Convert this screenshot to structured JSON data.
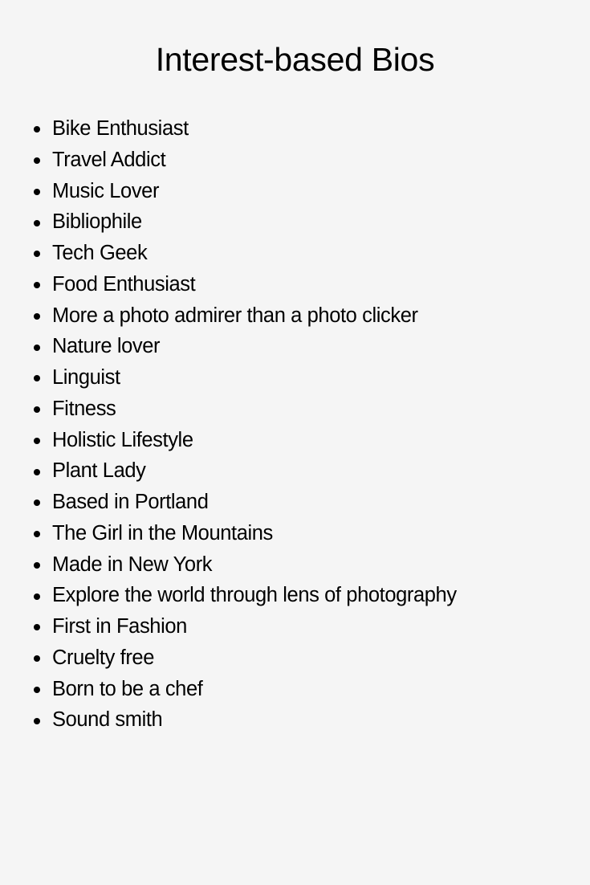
{
  "title": "Interest-based Bios",
  "bios": [
    "Bike Enthusiast",
    "Travel Addict",
    "Music Lover",
    "Bibliophile",
    "Tech Geek",
    "Food Enthusiast",
    "More a photo admirer than a photo clicker",
    "Nature lover",
    "Linguist",
    "Fitness",
    "Holistic Lifestyle",
    "Plant Lady",
    "Based in Portland",
    "The Girl in the Mountains",
    "Made in New York",
    "Explore the world through lens of photography",
    "First in Fashion",
    "Cruelty free",
    "Born to be a chef",
    "Sound smith"
  ],
  "colors": {
    "background": "#f5f5f5",
    "text": "#000000"
  }
}
